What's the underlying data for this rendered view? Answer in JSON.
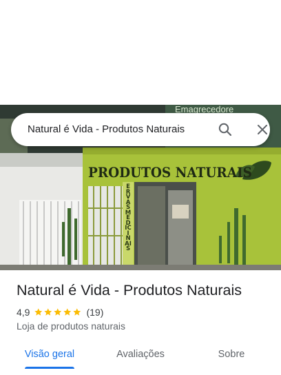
{
  "search": {
    "query": "Natural é Vida - Produtos Naturais"
  },
  "photo": {
    "sign_text": "PRODUTOS NATURAIS",
    "side_sign_text": "ERVAS MEDICINAIS",
    "top_sign_text": "Emagrecedore"
  },
  "place": {
    "name": "Natural é Vida - Produtos Naturais",
    "rating": "4,9",
    "stars": 5,
    "review_count": "(19)",
    "category": "Loja de produtos naturais"
  },
  "tabs": {
    "overview": "Visão geral",
    "reviews": "Avaliações",
    "about": "Sobre",
    "active": "overview"
  },
  "colors": {
    "accent": "#1a73e8",
    "star": "#fbbc04",
    "wall_green": "#a8c23a"
  }
}
